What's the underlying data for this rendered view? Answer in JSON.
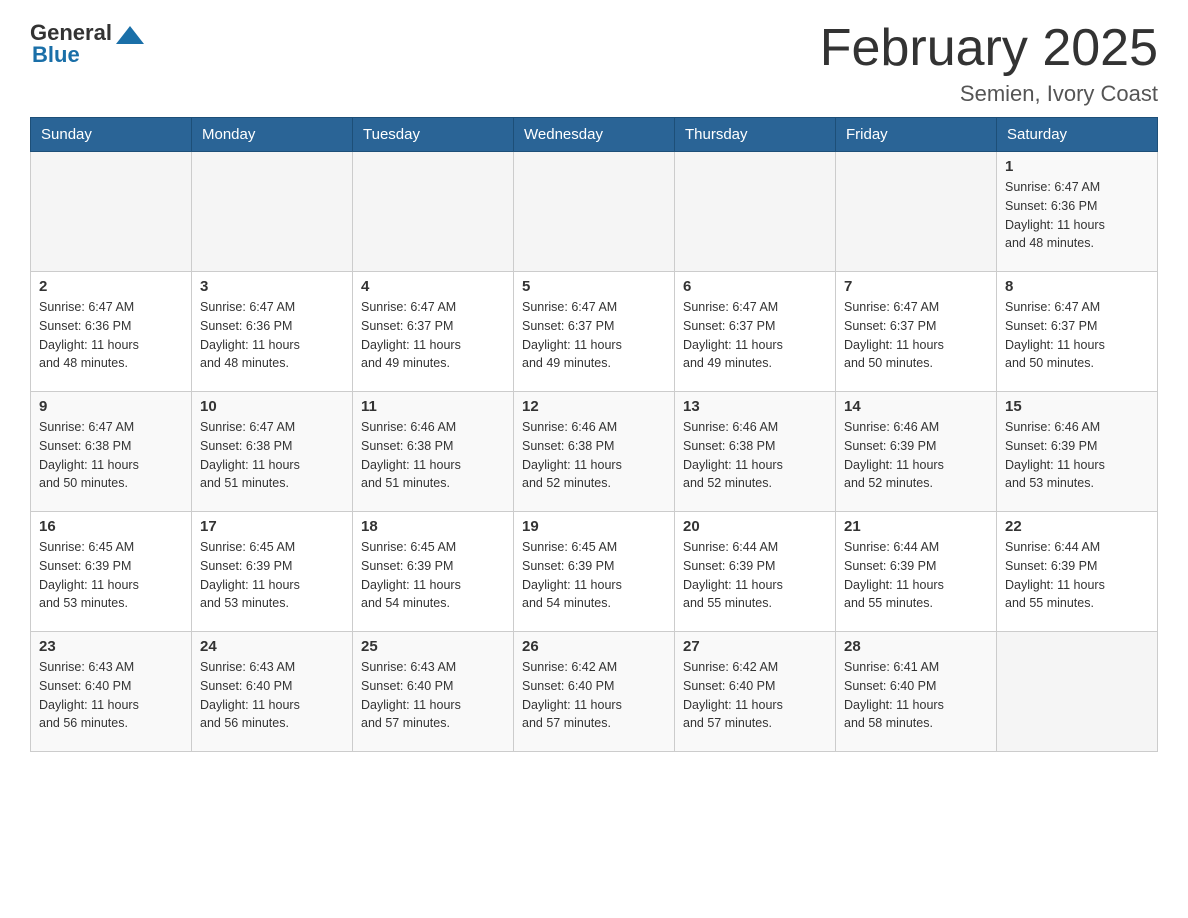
{
  "header": {
    "logo_general": "General",
    "logo_blue": "Blue",
    "title": "February 2025",
    "location": "Semien, Ivory Coast"
  },
  "weekdays": [
    "Sunday",
    "Monday",
    "Tuesday",
    "Wednesday",
    "Thursday",
    "Friday",
    "Saturday"
  ],
  "weeks": [
    [
      {
        "day": "",
        "info": ""
      },
      {
        "day": "",
        "info": ""
      },
      {
        "day": "",
        "info": ""
      },
      {
        "day": "",
        "info": ""
      },
      {
        "day": "",
        "info": ""
      },
      {
        "day": "",
        "info": ""
      },
      {
        "day": "1",
        "info": "Sunrise: 6:47 AM\nSunset: 6:36 PM\nDaylight: 11 hours\nand 48 minutes."
      }
    ],
    [
      {
        "day": "2",
        "info": "Sunrise: 6:47 AM\nSunset: 6:36 PM\nDaylight: 11 hours\nand 48 minutes."
      },
      {
        "day": "3",
        "info": "Sunrise: 6:47 AM\nSunset: 6:36 PM\nDaylight: 11 hours\nand 48 minutes."
      },
      {
        "day": "4",
        "info": "Sunrise: 6:47 AM\nSunset: 6:37 PM\nDaylight: 11 hours\nand 49 minutes."
      },
      {
        "day": "5",
        "info": "Sunrise: 6:47 AM\nSunset: 6:37 PM\nDaylight: 11 hours\nand 49 minutes."
      },
      {
        "day": "6",
        "info": "Sunrise: 6:47 AM\nSunset: 6:37 PM\nDaylight: 11 hours\nand 49 minutes."
      },
      {
        "day": "7",
        "info": "Sunrise: 6:47 AM\nSunset: 6:37 PM\nDaylight: 11 hours\nand 50 minutes."
      },
      {
        "day": "8",
        "info": "Sunrise: 6:47 AM\nSunset: 6:37 PM\nDaylight: 11 hours\nand 50 minutes."
      }
    ],
    [
      {
        "day": "9",
        "info": "Sunrise: 6:47 AM\nSunset: 6:38 PM\nDaylight: 11 hours\nand 50 minutes."
      },
      {
        "day": "10",
        "info": "Sunrise: 6:47 AM\nSunset: 6:38 PM\nDaylight: 11 hours\nand 51 minutes."
      },
      {
        "day": "11",
        "info": "Sunrise: 6:46 AM\nSunset: 6:38 PM\nDaylight: 11 hours\nand 51 minutes."
      },
      {
        "day": "12",
        "info": "Sunrise: 6:46 AM\nSunset: 6:38 PM\nDaylight: 11 hours\nand 52 minutes."
      },
      {
        "day": "13",
        "info": "Sunrise: 6:46 AM\nSunset: 6:38 PM\nDaylight: 11 hours\nand 52 minutes."
      },
      {
        "day": "14",
        "info": "Sunrise: 6:46 AM\nSunset: 6:39 PM\nDaylight: 11 hours\nand 52 minutes."
      },
      {
        "day": "15",
        "info": "Sunrise: 6:46 AM\nSunset: 6:39 PM\nDaylight: 11 hours\nand 53 minutes."
      }
    ],
    [
      {
        "day": "16",
        "info": "Sunrise: 6:45 AM\nSunset: 6:39 PM\nDaylight: 11 hours\nand 53 minutes."
      },
      {
        "day": "17",
        "info": "Sunrise: 6:45 AM\nSunset: 6:39 PM\nDaylight: 11 hours\nand 53 minutes."
      },
      {
        "day": "18",
        "info": "Sunrise: 6:45 AM\nSunset: 6:39 PM\nDaylight: 11 hours\nand 54 minutes."
      },
      {
        "day": "19",
        "info": "Sunrise: 6:45 AM\nSunset: 6:39 PM\nDaylight: 11 hours\nand 54 minutes."
      },
      {
        "day": "20",
        "info": "Sunrise: 6:44 AM\nSunset: 6:39 PM\nDaylight: 11 hours\nand 55 minutes."
      },
      {
        "day": "21",
        "info": "Sunrise: 6:44 AM\nSunset: 6:39 PM\nDaylight: 11 hours\nand 55 minutes."
      },
      {
        "day": "22",
        "info": "Sunrise: 6:44 AM\nSunset: 6:39 PM\nDaylight: 11 hours\nand 55 minutes."
      }
    ],
    [
      {
        "day": "23",
        "info": "Sunrise: 6:43 AM\nSunset: 6:40 PM\nDaylight: 11 hours\nand 56 minutes."
      },
      {
        "day": "24",
        "info": "Sunrise: 6:43 AM\nSunset: 6:40 PM\nDaylight: 11 hours\nand 56 minutes."
      },
      {
        "day": "25",
        "info": "Sunrise: 6:43 AM\nSunset: 6:40 PM\nDaylight: 11 hours\nand 57 minutes."
      },
      {
        "day": "26",
        "info": "Sunrise: 6:42 AM\nSunset: 6:40 PM\nDaylight: 11 hours\nand 57 minutes."
      },
      {
        "day": "27",
        "info": "Sunrise: 6:42 AM\nSunset: 6:40 PM\nDaylight: 11 hours\nand 57 minutes."
      },
      {
        "day": "28",
        "info": "Sunrise: 6:41 AM\nSunset: 6:40 PM\nDaylight: 11 hours\nand 58 minutes."
      },
      {
        "day": "",
        "info": ""
      }
    ]
  ]
}
